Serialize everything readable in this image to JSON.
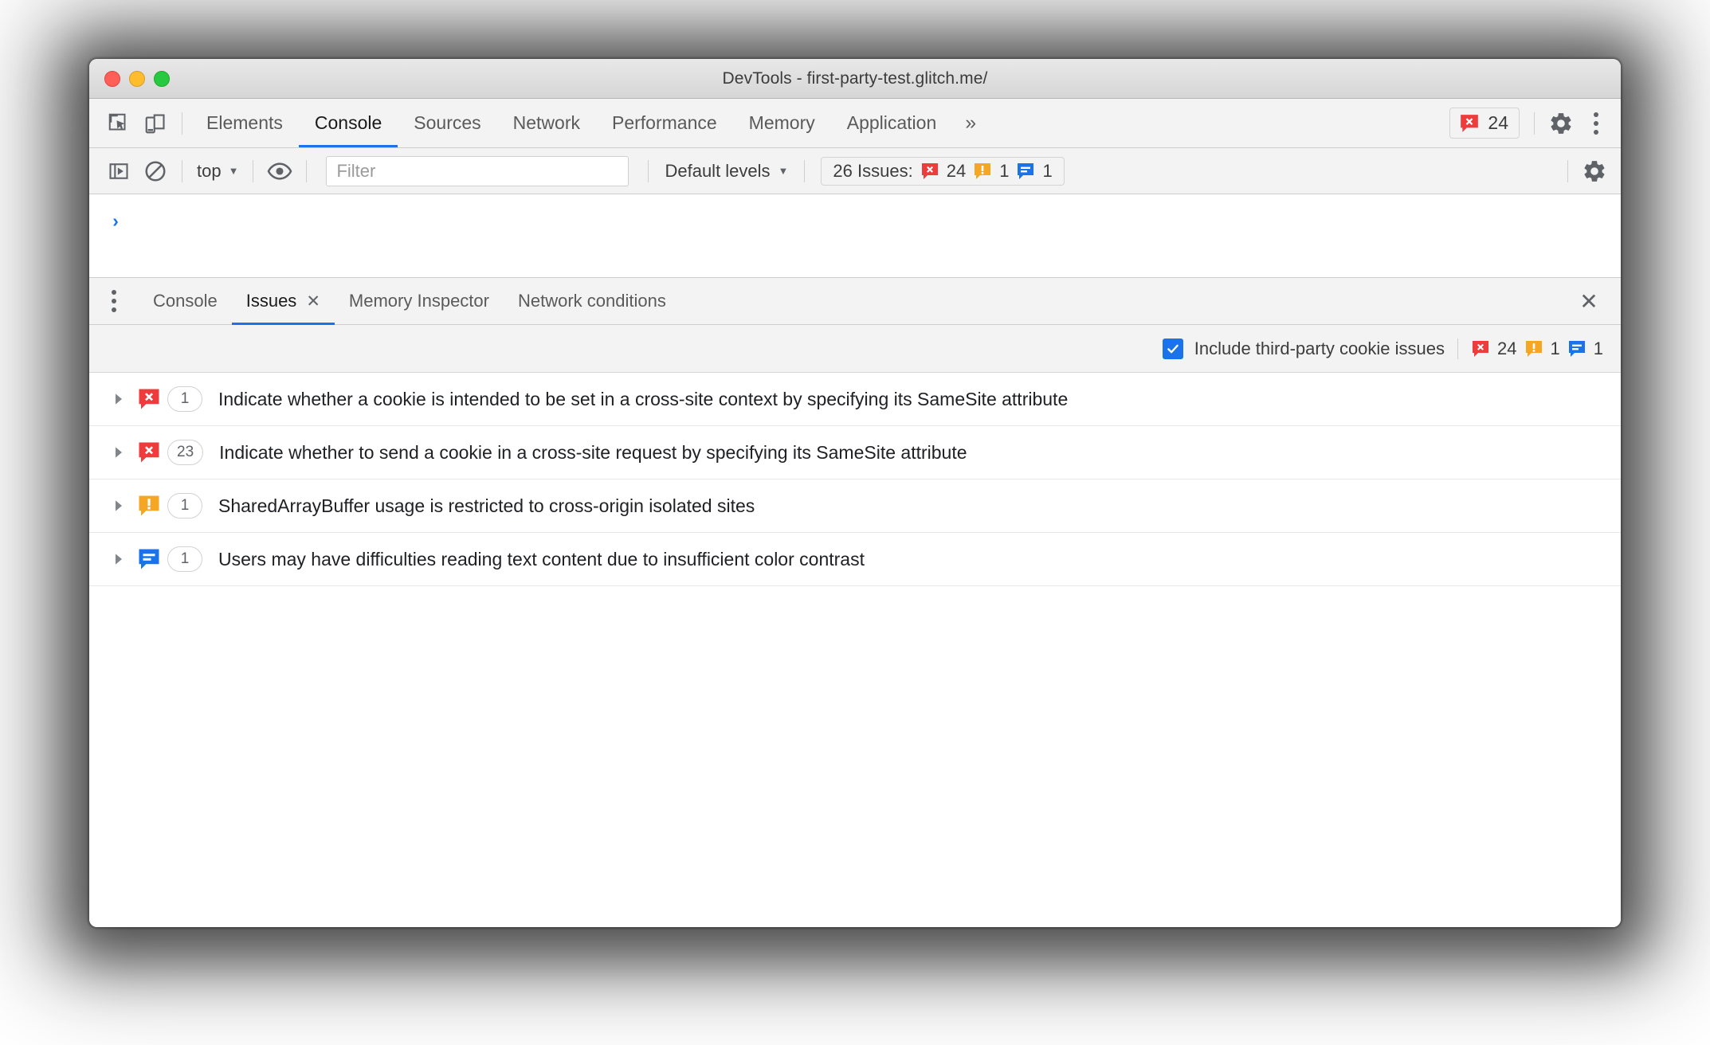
{
  "window": {
    "title": "DevTools - first-party-test.glitch.me/",
    "traffic_lights": [
      "close",
      "minimize",
      "zoom"
    ]
  },
  "main_tabs": {
    "left_icons": [
      "inspect-element-icon",
      "device-toolbar-icon"
    ],
    "items": [
      {
        "label": "Elements",
        "active": false
      },
      {
        "label": "Console",
        "active": true
      },
      {
        "label": "Sources",
        "active": false
      },
      {
        "label": "Network",
        "active": false
      },
      {
        "label": "Performance",
        "active": false
      },
      {
        "label": "Memory",
        "active": false
      },
      {
        "label": "Application",
        "active": false
      }
    ],
    "more_label": "»",
    "error_badge": {
      "icon": "error-icon",
      "count": "24"
    },
    "settings_icon": "gear-icon",
    "menu_icon": "kebab-menu-icon"
  },
  "console_toolbar": {
    "sidebar_toggle_icon": "console-sidebar-icon",
    "clear_icon": "clear-console-icon",
    "context_label": "top",
    "context_caret": "▼",
    "eye_icon": "live-expression-icon",
    "filter_placeholder": "Filter",
    "levels_label": "Default levels",
    "levels_caret": "▼",
    "issues_summary": {
      "label": "26 Issues:",
      "errors": "24",
      "warnings": "1",
      "info": "1"
    },
    "settings_icon": "gear-icon"
  },
  "console_body": {
    "prompt": "›"
  },
  "drawer": {
    "menu_icon": "kebab-menu-icon",
    "tabs": [
      {
        "label": "Console",
        "active": false,
        "closable": false
      },
      {
        "label": "Issues",
        "active": true,
        "closable": true,
        "close_glyph": "✕"
      },
      {
        "label": "Memory Inspector",
        "active": false,
        "closable": false
      },
      {
        "label": "Network conditions",
        "active": false,
        "closable": false
      }
    ],
    "close_glyph": "✕",
    "filter_bar": {
      "checkbox_checked": true,
      "checkbox_label": "Include third-party cookie issues",
      "errors": "24",
      "warnings": "1",
      "info": "1"
    },
    "issues": [
      {
        "severity": "error",
        "count": "1",
        "text": "Indicate whether a cookie is intended to be set in a cross-site context by specifying its SameSite attribute",
        "expanded": false
      },
      {
        "severity": "error",
        "count": "23",
        "text": "Indicate whether to send a cookie in a cross-site request by specifying its SameSite attribute",
        "expanded": false
      },
      {
        "severity": "warning",
        "count": "1",
        "text": "SharedArrayBuffer usage is restricted to cross-origin isolated sites",
        "expanded": false
      },
      {
        "severity": "info",
        "count": "1",
        "text": "Users may have difficulties reading text content due to insufficient color contrast",
        "expanded": false
      }
    ]
  },
  "colors": {
    "error": "#ee3b3b",
    "warning": "#f5a623",
    "info": "#1a73e8",
    "accent": "#1a73e8",
    "toolbar_bg": "#f3f3f3",
    "titlebar_bg": "#e0e0e0"
  }
}
